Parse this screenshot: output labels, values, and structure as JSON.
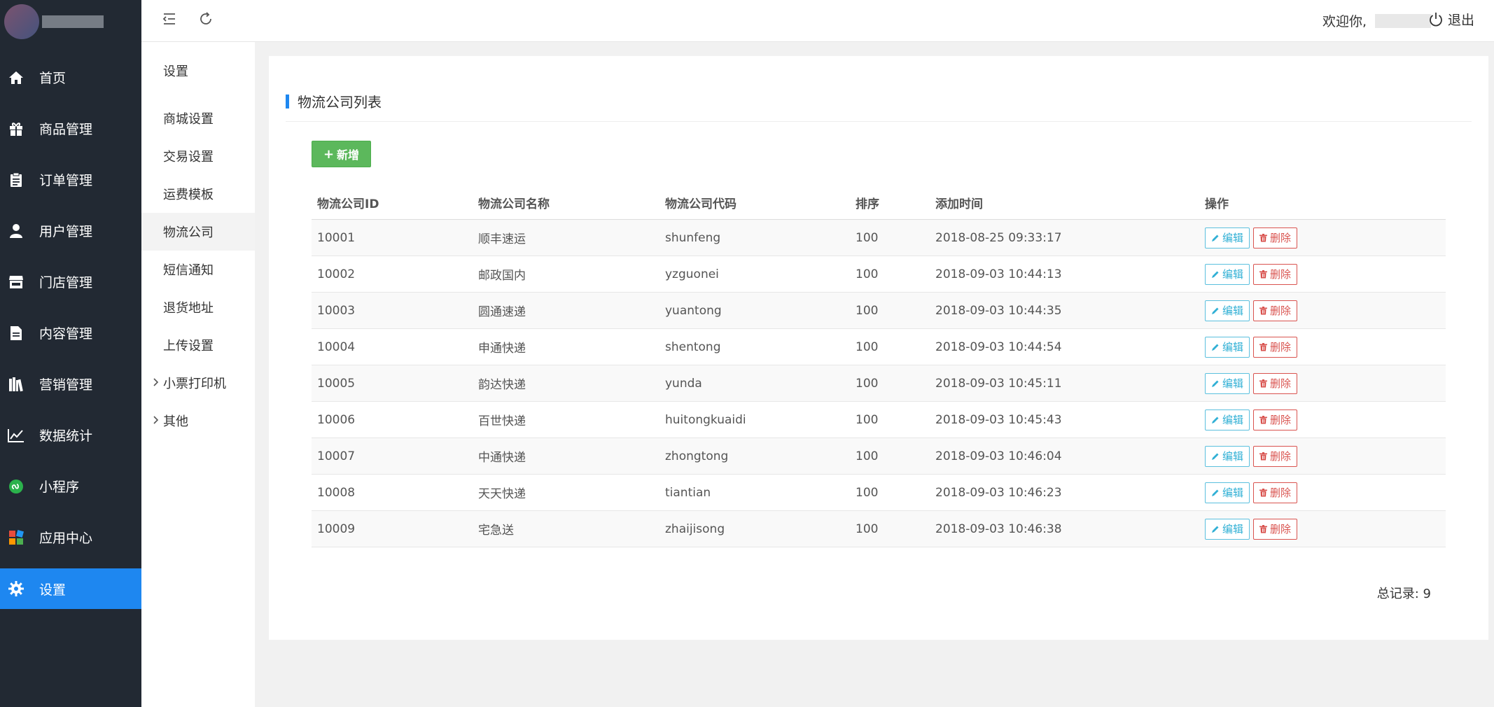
{
  "header": {
    "welcome_prefix": "欢迎你,",
    "logout_label": "退出"
  },
  "sidebar": {
    "items": [
      {
        "label": "首页",
        "icon": "home-icon"
      },
      {
        "label": "商品管理",
        "icon": "gift-icon"
      },
      {
        "label": "订单管理",
        "icon": "clipboard-icon"
      },
      {
        "label": "用户管理",
        "icon": "user-icon"
      },
      {
        "label": "门店管理",
        "icon": "store-icon"
      },
      {
        "label": "内容管理",
        "icon": "document-icon"
      },
      {
        "label": "营销管理",
        "icon": "books-icon"
      },
      {
        "label": "数据统计",
        "icon": "line-chart-icon"
      },
      {
        "label": "小程序",
        "icon": "mini-program-icon"
      },
      {
        "label": "应用中心",
        "icon": "apps-icon"
      },
      {
        "label": "设置",
        "icon": "gear-icon"
      }
    ]
  },
  "submenu": {
    "title": "设置",
    "items": [
      "商城设置",
      "交易设置",
      "运费模板",
      "物流公司",
      "短信通知",
      "退货地址",
      "上传设置",
      "小票打印机",
      "其他"
    ]
  },
  "panel": {
    "title": "物流公司列表",
    "add_label": "新增",
    "columns": [
      "物流公司ID",
      "物流公司名称",
      "物流公司代码",
      "排序",
      "添加时间",
      "操作"
    ],
    "edit_label": "编辑",
    "delete_label": "删除",
    "rows": [
      {
        "id": "10001",
        "name": "顺丰速运",
        "code": "shunfeng",
        "sort": "100",
        "time": "2018-08-25 09:33:17"
      },
      {
        "id": "10002",
        "name": "邮政国内",
        "code": "yzguonei",
        "sort": "100",
        "time": "2018-09-03 10:44:13"
      },
      {
        "id": "10003",
        "name": "圆通速递",
        "code": "yuantong",
        "sort": "100",
        "time": "2018-09-03 10:44:35"
      },
      {
        "id": "10004",
        "name": "申通快递",
        "code": "shentong",
        "sort": "100",
        "time": "2018-09-03 10:44:54"
      },
      {
        "id": "10005",
        "name": "韵达快递",
        "code": "yunda",
        "sort": "100",
        "time": "2018-09-03 10:45:11"
      },
      {
        "id": "10006",
        "name": "百世快递",
        "code": "huitongkuaidi",
        "sort": "100",
        "time": "2018-09-03 10:45:43"
      },
      {
        "id": "10007",
        "name": "中通快递",
        "code": "zhongtong",
        "sort": "100",
        "time": "2018-09-03 10:46:04"
      },
      {
        "id": "10008",
        "name": "天天快递",
        "code": "tiantian",
        "sort": "100",
        "time": "2018-09-03 10:46:23"
      },
      {
        "id": "10009",
        "name": "宅急送",
        "code": "zhaijisong",
        "sort": "100",
        "time": "2018-09-03 10:46:38"
      }
    ],
    "total_label": "总记录:",
    "total_count": "9"
  },
  "colors": {
    "sidebar_bg": "#222933",
    "accent": "#1e87f0",
    "add_button": "#5cb85c",
    "edit": "#5bc0de",
    "delete": "#d9534f"
  }
}
